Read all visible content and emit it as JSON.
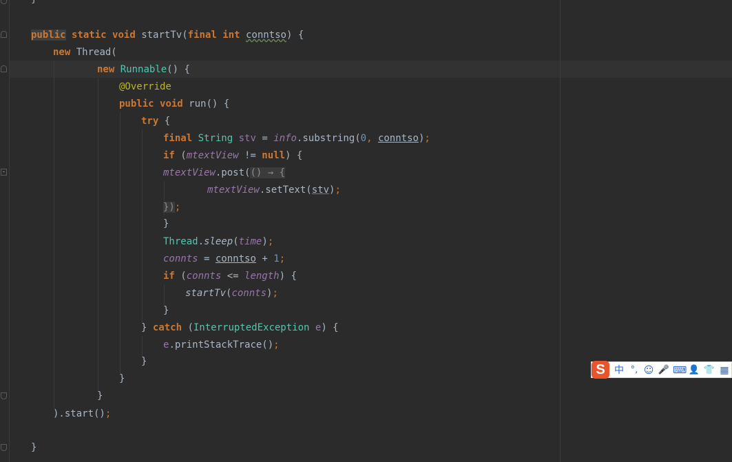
{
  "editor": {
    "lines": {
      "l0": "}",
      "l1": {
        "public": "public",
        "static": "static",
        "void": "void",
        "name": "startTv",
        "paren": "(",
        "final": "final",
        "int": "int",
        "param": "conntso",
        "close": ") {"
      },
      "l2": {
        "new": "new",
        "thread": "Thread("
      },
      "l3": {
        "new": "new",
        "runnable": "Runnable",
        "rest": "() {"
      },
      "l4": "@Override",
      "l5": {
        "public": "public",
        "void": "void",
        "rest": "run() {"
      },
      "l6": {
        "try": "try",
        "rest": " {"
      },
      "l7": {
        "final": "final",
        "string": "String",
        "var": "stv",
        "eq": " = ",
        "info": "info",
        "dot": ".substring(",
        "zero": "0",
        ", ": ", ",
        "param": "conntso",
        "close": ")",
        "semi": ";"
      },
      "l8": {
        "if": "if",
        "open": " (",
        "field": "mtextView",
        "ne": " != ",
        "null": "null",
        "close": ") {"
      },
      "l9": {
        "field": "mtextView",
        "rest": ".post(",
        "lambda": "() → {"
      },
      "l10": {
        "field": "mtextView",
        "rest": ".setText(",
        "arg": "stv",
        "close": ")",
        "semi": ";"
      },
      "l11": {
        "brace": "})",
        "semi": ";"
      },
      "l12": "}",
      "l13": {
        "thread": "Thread",
        "dot": ".",
        "sleep": "sleep",
        "open": "(",
        "time": "time",
        "close": ")",
        "semi": ";"
      },
      "l14": {
        "var": "connts",
        "eq": " = ",
        "param": "conntso",
        "plus": " + ",
        "one": "1",
        "semi": ";"
      },
      "l15": {
        "if": "if",
        "open": " (",
        "var": "connts",
        "le": " <= ",
        "len": "length",
        "close": ") {"
      },
      "l16": {
        "call": "startTv",
        "open": "(",
        "var": "connts",
        "close": ")",
        "semi": ";"
      },
      "l17": "}",
      "l18": {
        "brace": "} ",
        "catch": "catch",
        "open": " (",
        "exc": "InterruptedException",
        "e": " e",
        "close": ") {"
      },
      "l19": {
        "e": "e",
        "rest": ".printStackTrace()",
        "semi": ";"
      },
      "l20": "}",
      "l21": "}",
      "l22": "}",
      "l23": {
        "rest": ").start()",
        "semi": ";"
      },
      "l24": "}"
    }
  },
  "ime": {
    "logo": "S",
    "items": [
      "中",
      "°,",
      "☺",
      "🎤",
      "⌨",
      "👤",
      "👕",
      "▦"
    ]
  },
  "colors": {
    "background": "#2b2b2b",
    "keyword": "#cc7832",
    "field": "#9876aa",
    "annotation": "#bbb529",
    "number": "#6897bb",
    "text": "#a9b7c6"
  }
}
